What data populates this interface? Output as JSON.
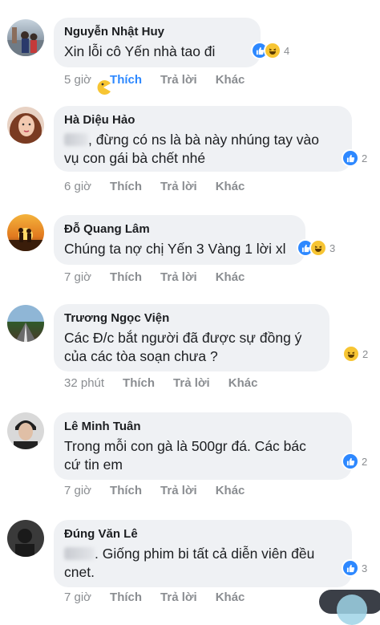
{
  "comments": [
    {
      "author": "Nguyễn Nhật Huy",
      "text": "Xin lỗi cô Yến nhà tao đi",
      "text_prefix": "",
      "reaction_count": "4",
      "time": "5 giờ",
      "like": "Thích",
      "reply": "Trả lời",
      "more": "Khác",
      "emoji": "pacman"
    },
    {
      "author": "Hà Diệu Hảo",
      "text_prefix": "",
      "text": ", đừng có ns là bà này nhúng tay vào\nvụ con gái bà chết nhé",
      "reaction_count": "2",
      "time": "6 giờ",
      "like": "Thích",
      "reply": "Trả lời",
      "more": "Khác"
    },
    {
      "author": "Đỗ Quang Lâm",
      "text": "Chúng ta nợ chị Yến 3 Vàng 1 lời xl",
      "reaction_count": "3",
      "time": "7 giờ",
      "like": "Thích",
      "reply": "Trả lời",
      "more": "Khác"
    },
    {
      "author": "Trương Ngọc Viện",
      "text": "Các Đ/c bắt người đã được sự đồng ý\ncủa các tòa soạn chưa ?",
      "reaction_count": "2",
      "time": "32 phút",
      "like": "Thích",
      "reply": "Trả lời",
      "more": "Khác"
    },
    {
      "author": "Lê Minh Tuân",
      "text": "Trong mỗi con gà là 500gr đá. Các bác\ncứ tin em",
      "reaction_count": "2",
      "time": "7 giờ",
      "like": "Thích",
      "reply": "Trả lời",
      "more": "Khác"
    },
    {
      "author": "Đúng Văn Lê",
      "text": ". Giống phim bi tất cả diễn viên đều\ncnet.",
      "reaction_count": "3",
      "time": "7 giờ",
      "like": "Thích",
      "reply": "Trả lời",
      "more": "Khác"
    }
  ],
  "colors": {
    "bubble": "#eff1f4",
    "meta": "#8a8d91",
    "liked": "#2d88ff",
    "like_icon": "#2d88ff",
    "haha_icon": "#f7c533"
  }
}
